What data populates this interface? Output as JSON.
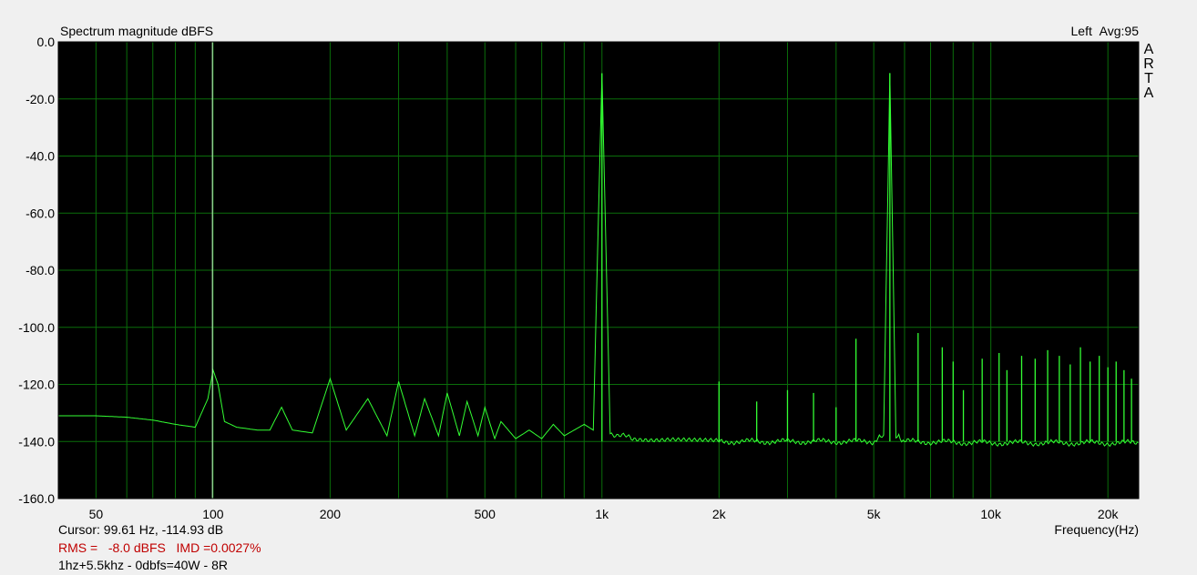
{
  "chart_data": {
    "type": "line",
    "title": "Spectrum magnitude dBFS",
    "channel_label": "Left",
    "avg_label": "Avg:95",
    "brand": "ARTA",
    "xlabel": "Frequency(Hz)",
    "ylabel": "",
    "x_scale": "log",
    "xlim": [
      40,
      24000
    ],
    "ylim": [
      -160,
      0
    ],
    "grid": true,
    "colors": {
      "background": "#000000",
      "grid": "#0a6e0a",
      "trace": "#33ff33",
      "cursor": "#ccffcc",
      "measurement_text": "#c00000"
    },
    "y_ticks": [
      {
        "value": 0,
        "label": "0.0"
      },
      {
        "value": -20,
        "label": "-20.0"
      },
      {
        "value": -40,
        "label": "-40.0"
      },
      {
        "value": -60,
        "label": "-60.0"
      },
      {
        "value": -80,
        "label": "-80.0"
      },
      {
        "value": -100,
        "label": "-100.0"
      },
      {
        "value": -120,
        "label": "-120.0"
      },
      {
        "value": -140,
        "label": "-140.0"
      },
      {
        "value": -160,
        "label": "-160.0"
      }
    ],
    "x_ticks": [
      {
        "value": 50,
        "label": "50"
      },
      {
        "value": 100,
        "label": "100"
      },
      {
        "value": 200,
        "label": "200"
      },
      {
        "value": 500,
        "label": "500"
      },
      {
        "value": 1000,
        "label": "1k"
      },
      {
        "value": 2000,
        "label": "2k"
      },
      {
        "value": 5000,
        "label": "5k"
      },
      {
        "value": 10000,
        "label": "10k"
      },
      {
        "value": 20000,
        "label": "20k"
      }
    ],
    "minor_grid_x": [
      40,
      50,
      60,
      70,
      80,
      90,
      100,
      200,
      300,
      400,
      500,
      600,
      700,
      800,
      900,
      1000,
      2000,
      3000,
      4000,
      5000,
      6000,
      7000,
      8000,
      9000,
      10000,
      20000
    ],
    "cursor_freq": 99.61,
    "noise_floor": [
      [
        40,
        -131
      ],
      [
        50,
        -131
      ],
      [
        60,
        -131.5
      ],
      [
        70,
        -132.5
      ],
      [
        80,
        -134
      ],
      [
        90,
        -135
      ],
      [
        97,
        -125
      ],
      [
        100,
        -115
      ],
      [
        103,
        -120
      ],
      [
        107,
        -133
      ],
      [
        115,
        -135
      ],
      [
        130,
        -136
      ],
      [
        140,
        -136
      ],
      [
        150,
        -128
      ],
      [
        160,
        -136
      ],
      [
        180,
        -137
      ],
      [
        200,
        -118
      ],
      [
        220,
        -136
      ],
      [
        250,
        -125
      ],
      [
        280,
        -138
      ],
      [
        300,
        -119
      ],
      [
        330,
        -138
      ],
      [
        350,
        -125
      ],
      [
        380,
        -138
      ],
      [
        400,
        -123
      ],
      [
        430,
        -138
      ],
      [
        450,
        -126
      ],
      [
        480,
        -138
      ],
      [
        500,
        -128
      ],
      [
        530,
        -139
      ],
      [
        550,
        -133
      ],
      [
        600,
        -139
      ],
      [
        650,
        -136
      ],
      [
        700,
        -139
      ],
      [
        750,
        -134
      ],
      [
        800,
        -138
      ],
      [
        900,
        -134
      ],
      [
        950,
        -136
      ],
      [
        1000,
        -11
      ],
      [
        1050,
        -137
      ],
      [
        1200,
        -139
      ],
      [
        1500,
        -139
      ],
      [
        2000,
        -140
      ],
      [
        3000,
        -140
      ],
      [
        5000,
        -140
      ],
      [
        5300,
        -138
      ],
      [
        5500,
        -11
      ],
      [
        5700,
        -138
      ],
      [
        6000,
        -140
      ],
      [
        10000,
        -140.5
      ],
      [
        24000,
        -140.5
      ]
    ],
    "peaks": [
      {
        "x": 1000,
        "y": -11
      },
      {
        "x": 5500,
        "y": -11
      },
      {
        "x": 4500,
        "y": -104
      },
      {
        "x": 6500,
        "y": -102
      },
      {
        "x": 2000,
        "y": -119
      },
      {
        "x": 3000,
        "y": -122
      },
      {
        "x": 3500,
        "y": -123
      },
      {
        "x": 4000,
        "y": -128
      },
      {
        "x": 2500,
        "y": -126
      },
      {
        "x": 7500,
        "y": -107
      },
      {
        "x": 8000,
        "y": -112
      },
      {
        "x": 8500,
        "y": -122
      },
      {
        "x": 9500,
        "y": -111
      },
      {
        "x": 10500,
        "y": -109
      },
      {
        "x": 11000,
        "y": -115
      },
      {
        "x": 12000,
        "y": -110
      },
      {
        "x": 13000,
        "y": -111
      },
      {
        "x": 14000,
        "y": -108
      },
      {
        "x": 15000,
        "y": -110
      },
      {
        "x": 16000,
        "y": -113
      },
      {
        "x": 17000,
        "y": -107
      },
      {
        "x": 18000,
        "y": -112
      },
      {
        "x": 19000,
        "y": -110
      },
      {
        "x": 20000,
        "y": -114
      },
      {
        "x": 21000,
        "y": -112
      },
      {
        "x": 22000,
        "y": -115
      },
      {
        "x": 23000,
        "y": -118
      }
    ],
    "cursor_readout": "Cursor: 99.61 Hz, -114.93 dB",
    "measurement_readout": "RMS =   -8.0 dBFS   IMD =0.0027%",
    "note": "1hz+5.5khz - 0dbfs=40W - 8R"
  }
}
